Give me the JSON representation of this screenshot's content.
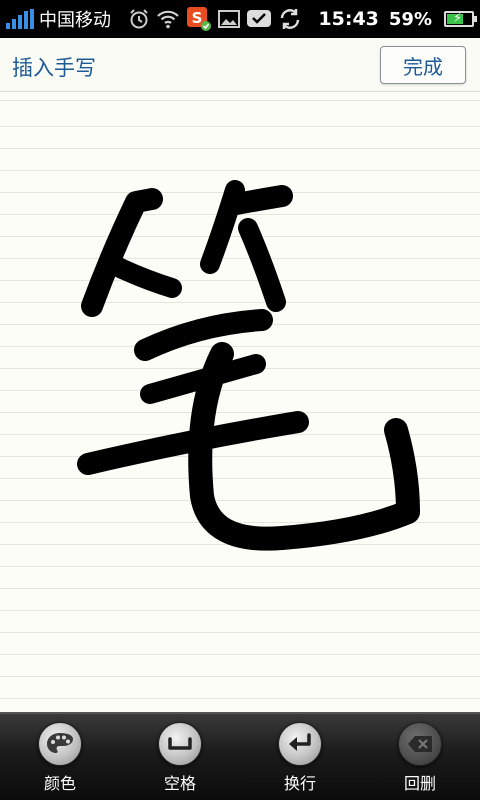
{
  "status_bar": {
    "carrier": "中国移动",
    "time": "15:43",
    "battery_percent": "59%",
    "icons": [
      "signal-icon",
      "alarm-icon",
      "wifi-icon",
      "sogou-input-icon",
      "image-icon",
      "message-check-icon",
      "sync-icon",
      "battery-charging-icon"
    ]
  },
  "header": {
    "title": "插入手写",
    "done_label": "完成"
  },
  "canvas": {
    "ink_color": "#000000",
    "background": "#fdfdf8"
  },
  "toolbar": {
    "items": [
      {
        "label": "颜色",
        "icon": "palette-icon"
      },
      {
        "label": "空格",
        "icon": "space-icon"
      },
      {
        "label": "换行",
        "icon": "enter-icon"
      },
      {
        "label": "回删",
        "icon": "backspace-icon"
      }
    ]
  },
  "colors": {
    "accent_text": "#1e5a96",
    "signal": "#3a8ee6",
    "battery": "#3cc24a"
  }
}
